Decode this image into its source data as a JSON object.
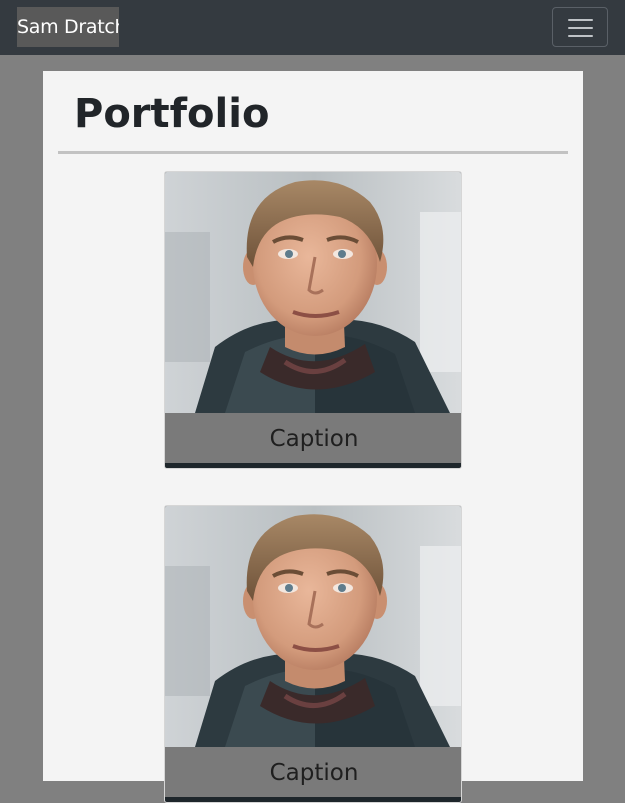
{
  "navbar": {
    "brand": "Sam Dratch",
    "toggler_icon": "hamburger-icon"
  },
  "main": {
    "title": "Portfolio",
    "cards": [
      {
        "caption": "Caption",
        "image": "portrait-photo"
      },
      {
        "caption": "Caption",
        "image": "portrait-photo"
      }
    ]
  },
  "colors": {
    "navbar_bg": "#343a40",
    "page_bg": "#808080",
    "panel_bg": "#f4f4f4",
    "caption_bg": "#7a7a7a"
  }
}
